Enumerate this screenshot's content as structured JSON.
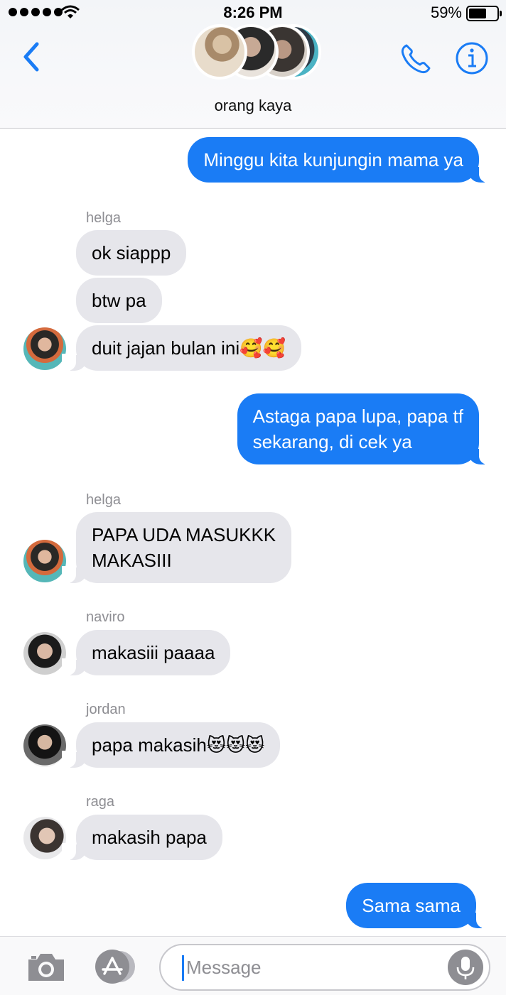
{
  "status_bar": {
    "time": "8:26 PM",
    "battery_percent": "59%",
    "battery_level": 0.59,
    "signal_bars": 5,
    "icons": [
      "signal-dots-icon",
      "wifi-icon",
      "battery-icon"
    ]
  },
  "header": {
    "group_name": "orang kaya",
    "icons": [
      "back-chevron-icon",
      "phone-icon",
      "info-icon"
    ],
    "accent_color": "#1a7cf5"
  },
  "messages": [
    {
      "direction": "outgoing",
      "text": "Minggu kita kunjungin mama ya"
    },
    {
      "direction": "incoming",
      "sender": "helga",
      "text": "ok siappp"
    },
    {
      "direction": "incoming",
      "text": "btw pa"
    },
    {
      "direction": "incoming",
      "text": "duit jajan bulan ini🥰🥰"
    },
    {
      "direction": "outgoing",
      "lines": [
        "Astaga papa lupa, papa tf",
        "sekarang, di cek ya"
      ]
    },
    {
      "direction": "incoming",
      "sender": "helga",
      "lines": [
        "PAPA UDA MASUKKK",
        "MAKASIII"
      ]
    },
    {
      "direction": "incoming",
      "sender": "naviro",
      "text": "makasiii paaaa"
    },
    {
      "direction": "incoming",
      "sender": "jordan",
      "text": "papa makasih😻😻😻"
    },
    {
      "direction": "incoming",
      "sender": "raga",
      "text": "makasih papa"
    },
    {
      "direction": "outgoing",
      "text": "Sama sama"
    }
  ],
  "input_bar": {
    "placeholder": "Message",
    "icons": [
      "camera-icon",
      "app-store-icon",
      "microphone-icon"
    ]
  },
  "colors": {
    "outgoing_bubble": "#1a7cf5",
    "incoming_bubble": "#e6e6eb",
    "sender_label": "#8e8e93"
  }
}
